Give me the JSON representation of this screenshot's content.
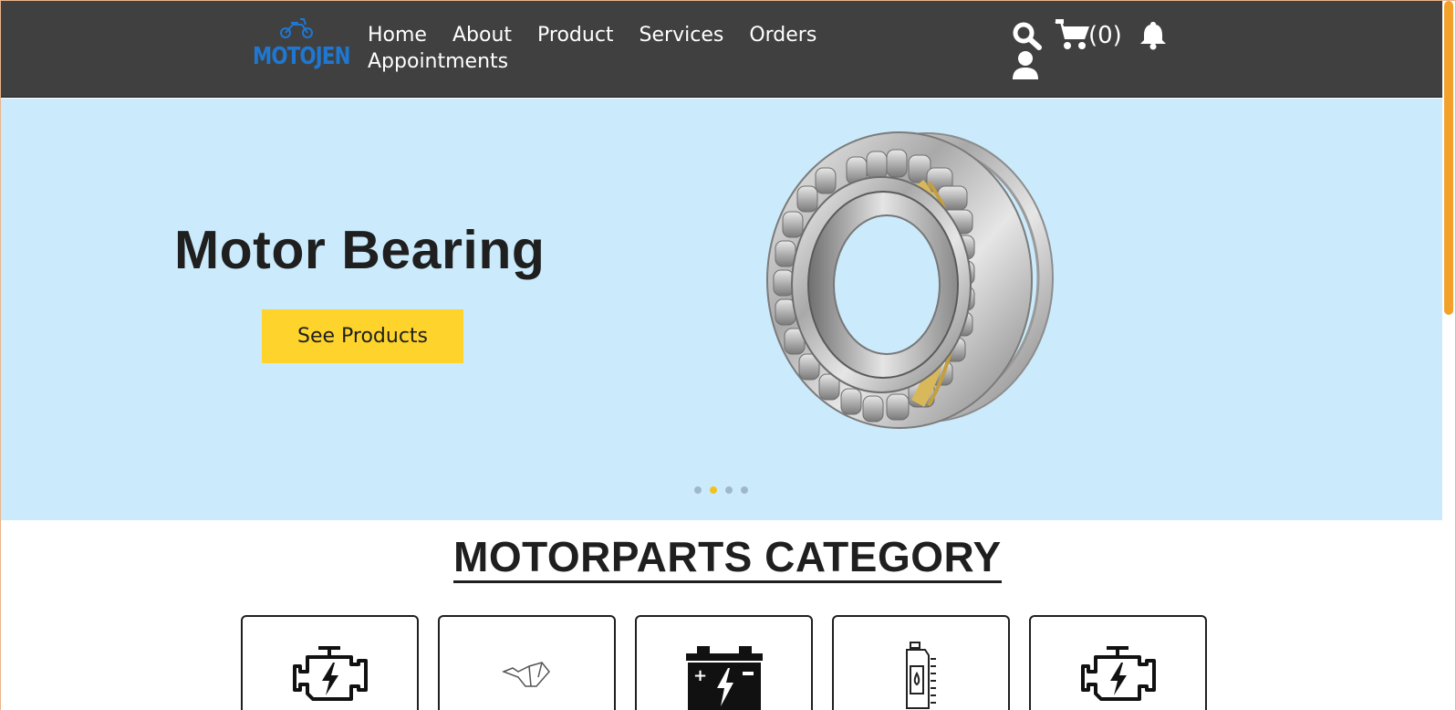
{
  "header": {
    "logo_text": "MOTOJEN",
    "nav": [
      "Home",
      "About",
      "Product",
      "Services",
      "Orders",
      "Appointments"
    ],
    "cart_count": "(0)",
    "icons": [
      "search-icon",
      "cart-icon",
      "bell-icon",
      "user-icon"
    ]
  },
  "hero": {
    "title": "Motor Bearing",
    "button_label": "See Products",
    "image": "motor-bearing-image",
    "slides_count": 4,
    "active_slide": 2
  },
  "category": {
    "title": "MOTORPARTS CATEGORY",
    "card_icons": [
      "engine-icon",
      "motorcycle-frame-icon",
      "battery-icon",
      "oil-bottle-icon",
      "engine-icon"
    ]
  },
  "colors": {
    "header_bg": "#404040",
    "hero_bg": "#cbebfc",
    "accent_yellow": "#fdd32c",
    "logo_blue": "#1e78d2",
    "scrollbar": "#f2a12b"
  }
}
